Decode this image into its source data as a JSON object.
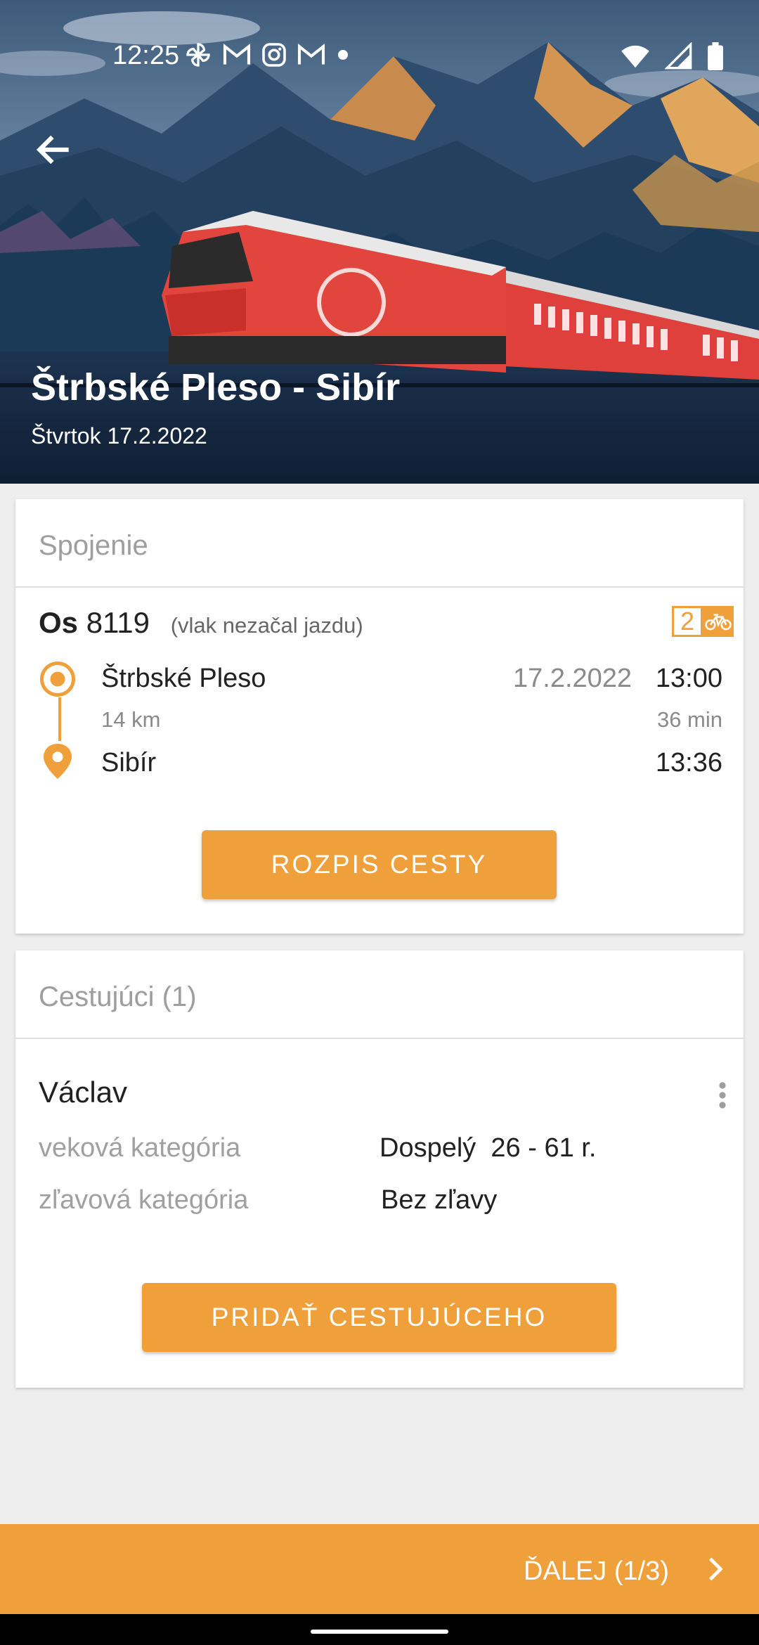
{
  "status_bar": {
    "time": "12:25"
  },
  "hero": {
    "title": "Štrbské Pleso - Sibír",
    "date": "Štvrtok 17.2.2022"
  },
  "connection_card": {
    "header": "Spojenie",
    "train_category": "Os",
    "train_number": "8119",
    "train_status": "(vlak nezačal jazdu)",
    "class_badge": "2",
    "from_station": "Štrbské Pleso",
    "from_date": "17.2.2022",
    "from_time": "13:00",
    "distance": "14 km",
    "duration": "36 min",
    "to_station": "Sibír",
    "to_time": "13:36",
    "button_label": "ROZPIS CESTY"
  },
  "passengers_card": {
    "header": "Cestujúci (1)",
    "name": "Václav",
    "age_label": "veková kategória",
    "age_value": "Dospelý  26 - 61 r.",
    "discount_label": "zľavová kategória",
    "discount_value": "Bez zľavy",
    "button_label": "PRIDAŤ CESTUJÚCEHO"
  },
  "footer": {
    "next_label": "ĎALEJ (1/3)"
  },
  "colors": {
    "accent": "#f0a03a",
    "background": "#eeeeee",
    "card": "#ffffff"
  }
}
